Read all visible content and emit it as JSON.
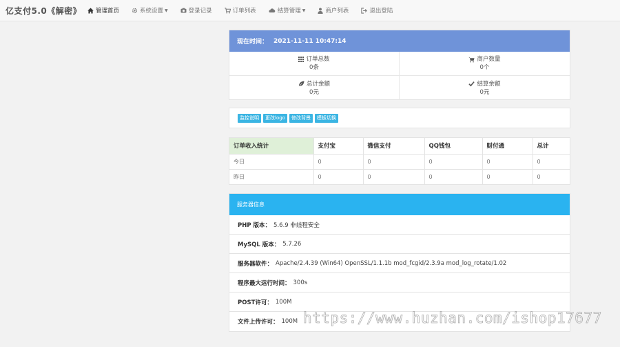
{
  "navbar": {
    "brand": "亿支付5.0《解密》",
    "items": [
      {
        "label": "管理首页",
        "icon": "home-icon",
        "active": true,
        "dropdown": false
      },
      {
        "label": "系统设置",
        "icon": "gear-icon",
        "active": false,
        "dropdown": true
      },
      {
        "label": "登录记录",
        "icon": "camera-icon",
        "active": false,
        "dropdown": false
      },
      {
        "label": "订单列表",
        "icon": "cart-icon",
        "active": false,
        "dropdown": false
      },
      {
        "label": "结算管理",
        "icon": "cloud-icon",
        "active": false,
        "dropdown": true
      },
      {
        "label": "商户列表",
        "icon": "user-icon",
        "active": false,
        "dropdown": false
      },
      {
        "label": "退出登陆",
        "icon": "logout-icon",
        "active": false,
        "dropdown": false
      }
    ]
  },
  "time_panel": {
    "label": "现在时间：",
    "value": "2021-11-11 10:47:14",
    "header_color": "#6f93d9",
    "stats": [
      {
        "title": "订单总数",
        "value": "0条",
        "icon": "grid-icon"
      },
      {
        "title": "商户数量",
        "value": "0个",
        "icon": "cart-icon"
      },
      {
        "title": "总计余额",
        "value": "0元",
        "icon": "leaf-icon"
      },
      {
        "title": "结算余额",
        "value": "0元",
        "icon": "check-icon"
      }
    ]
  },
  "buttons": [
    "监控说明",
    "更改logo",
    "修改背景",
    "模板切换"
  ],
  "button_color": "#3bb5e3",
  "income": {
    "headers": [
      "订单收入统计",
      "支付宝",
      "微信支付",
      "QQ钱包",
      "财付通",
      "总计"
    ],
    "rows": [
      [
        "今日",
        "0",
        "0",
        "0",
        "0",
        "0"
      ],
      [
        "昨日",
        "0",
        "0",
        "0",
        "0",
        "0"
      ]
    ]
  },
  "server": {
    "title": "服务器信息",
    "header_color": "#2ab3f0",
    "rows": [
      {
        "key": "PHP 版本：",
        "value": "5.6.9 非线程安全"
      },
      {
        "key": "MySQL 版本：",
        "value": "5.7.26"
      },
      {
        "key": "服务器软件：",
        "value": "Apache/2.4.39 (Win64) OpenSSL/1.1.1b mod_fcgid/2.3.9a mod_log_rotate/1.02"
      },
      {
        "key": "程序最大运行时间：",
        "value": "300s"
      },
      {
        "key": "POST许可：",
        "value": "100M"
      },
      {
        "key": "文件上传许可：",
        "value": "100M"
      }
    ]
  },
  "watermark": "https://www.huzhan.com/ishop17677"
}
